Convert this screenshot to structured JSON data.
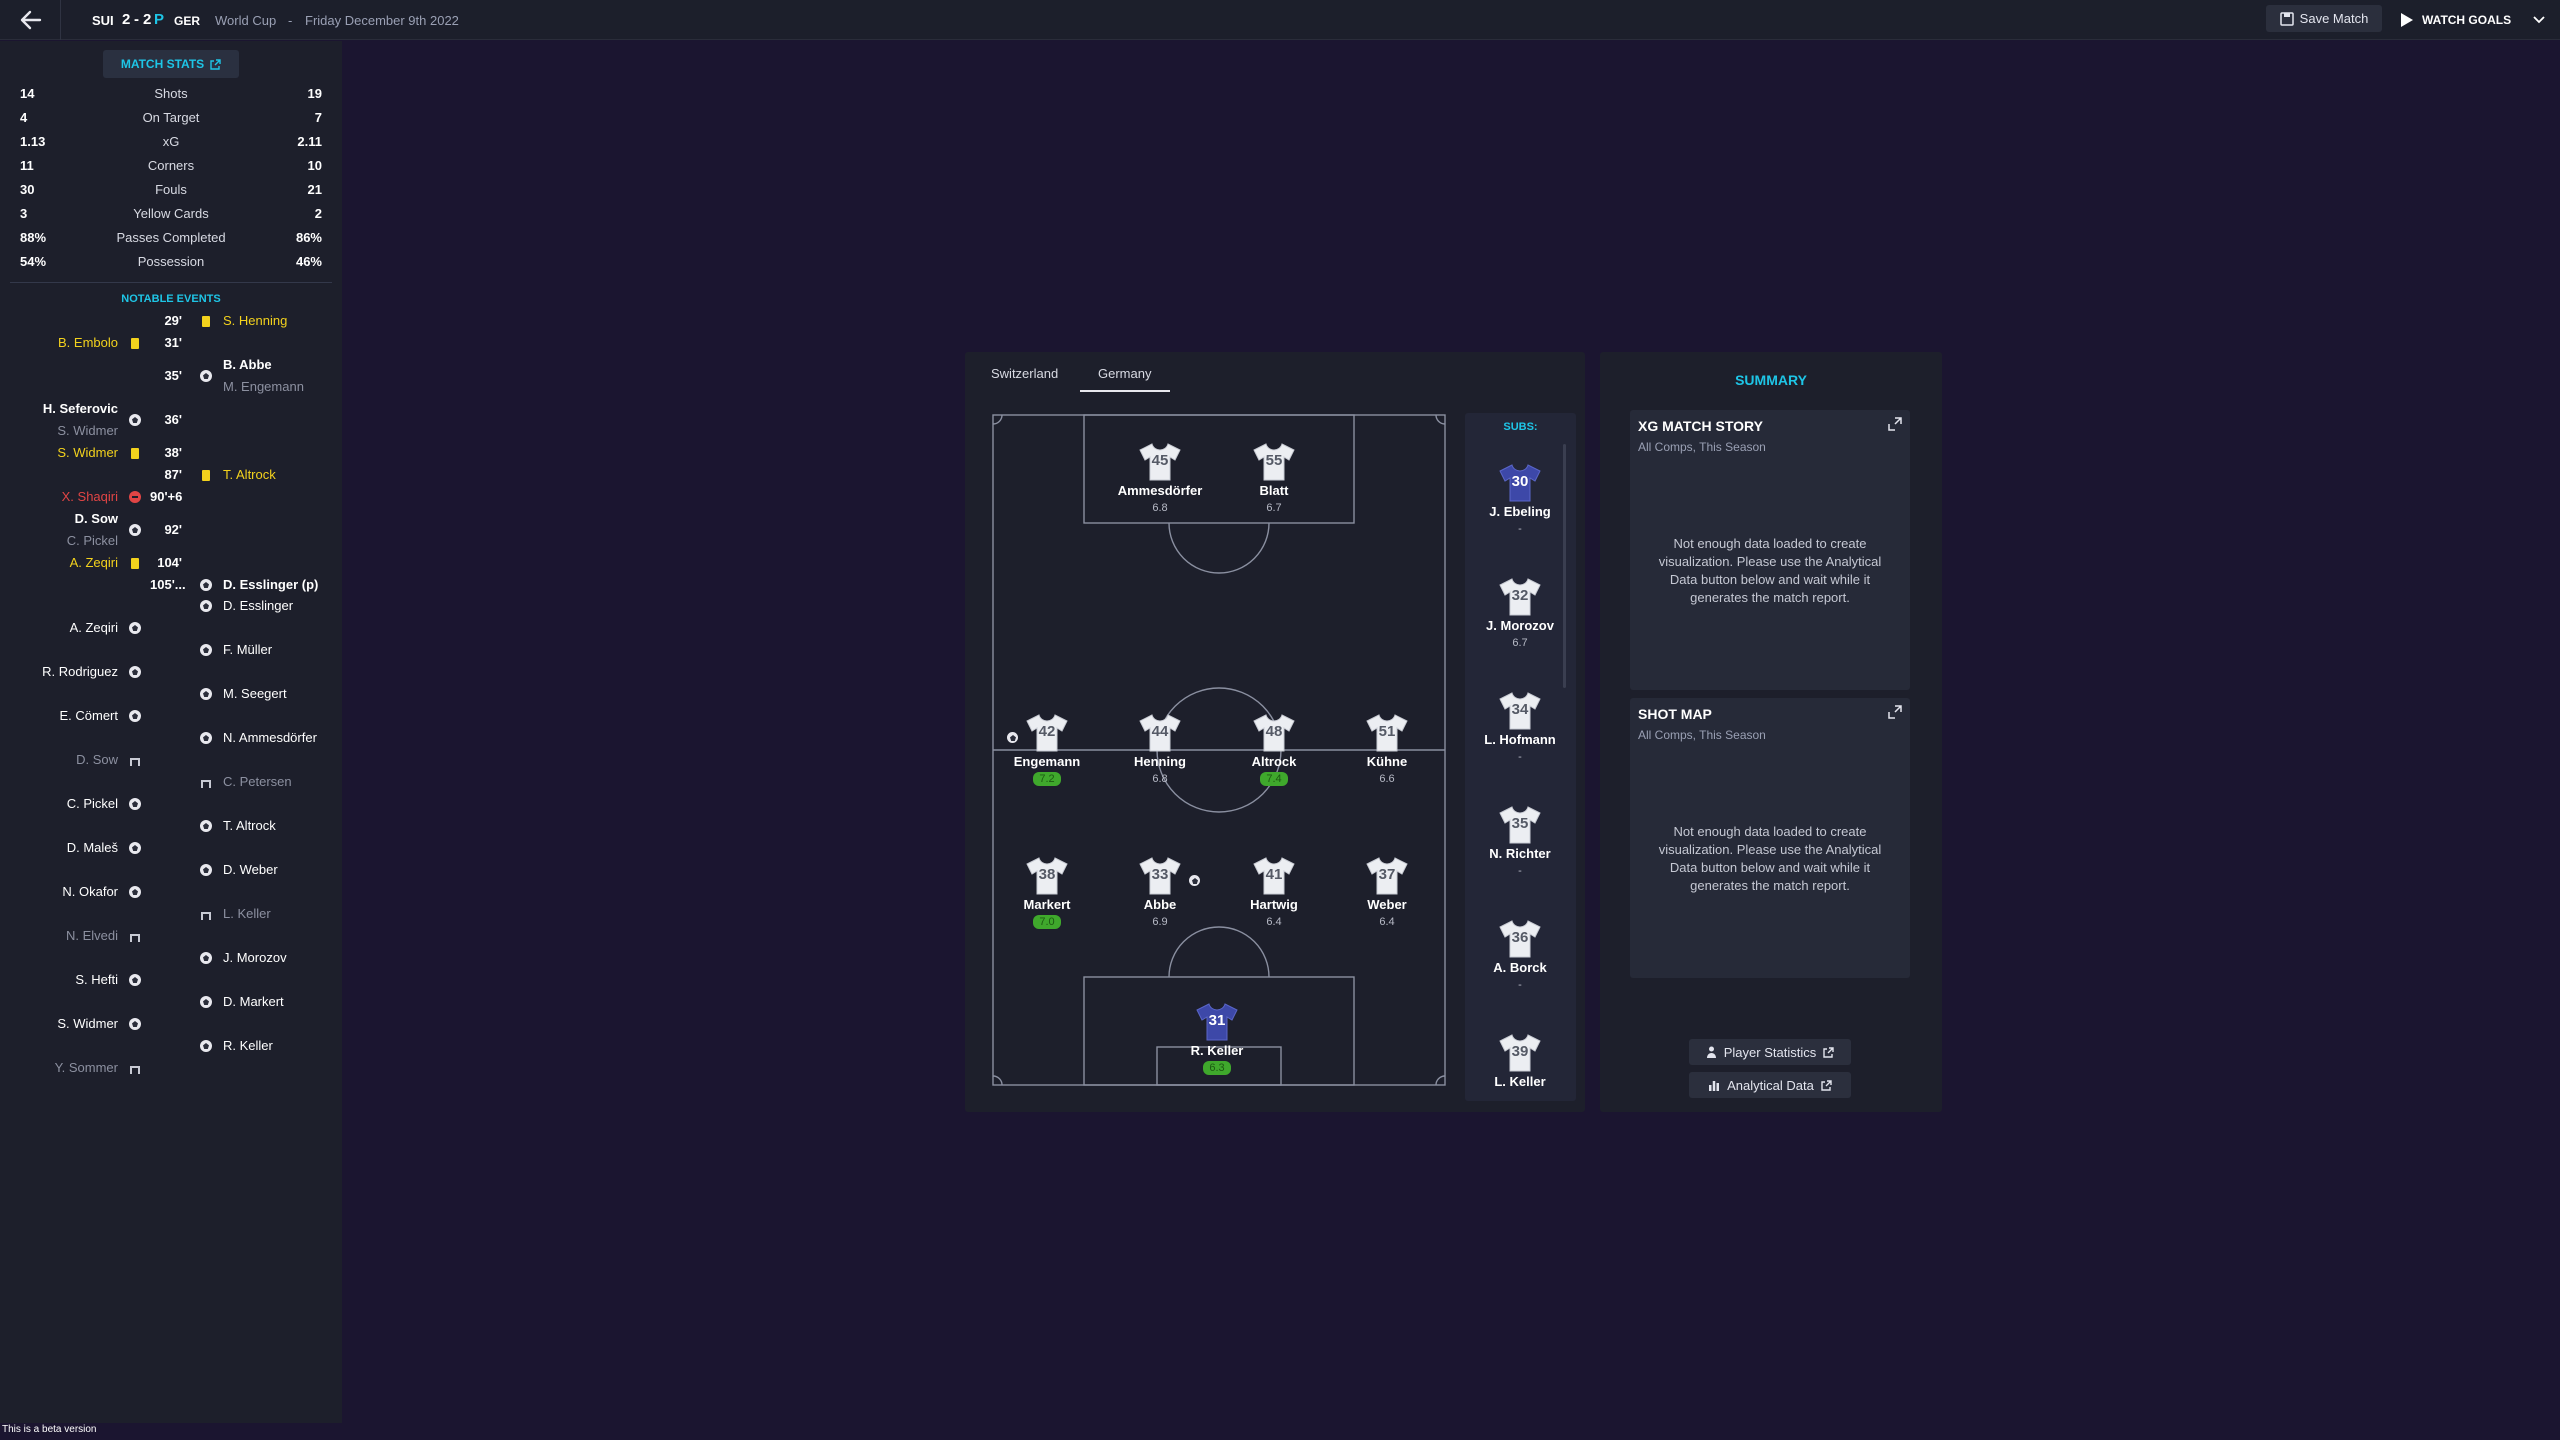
{
  "topbar": {
    "home_abbr": "SUI",
    "score_home": "2",
    "score_sep": "-",
    "score_away": "2",
    "penalty_marker": "P",
    "away_abbr": "GER",
    "competition": "World Cup",
    "separator": "-",
    "date": "Friday December 9th 2022",
    "save_label": "Save Match",
    "watch_label": "WATCH GOALS"
  },
  "match_stats": {
    "button_label": "MATCH STATS",
    "rows": [
      {
        "label": "Shots",
        "home": "14",
        "away": "19"
      },
      {
        "label": "On Target",
        "home": "4",
        "away": "7"
      },
      {
        "label": "xG",
        "home": "1.13",
        "away": "2.11"
      },
      {
        "label": "Corners",
        "home": "11",
        "away": "10"
      },
      {
        "label": "Fouls",
        "home": "30",
        "away": "21"
      },
      {
        "label": "Yellow Cards",
        "home": "3",
        "away": "2"
      },
      {
        "label": "Passes Completed",
        "home": "88%",
        "away": "86%"
      },
      {
        "label": "Possession",
        "home": "54%",
        "away": "46%"
      }
    ]
  },
  "notable_events": {
    "title": "NOTABLE EVENTS",
    "events": [
      {
        "minute": "29'",
        "side": "away",
        "type": "yellow",
        "name": "S. Henning",
        "sub": ""
      },
      {
        "minute": "31'",
        "side": "home",
        "type": "yellow",
        "name": "B. Embolo",
        "sub": ""
      },
      {
        "minute": "35'",
        "side": "away",
        "type": "goal",
        "name": "B. Abbe",
        "sub": "M. Engemann"
      },
      {
        "minute": "36'",
        "side": "home",
        "type": "goal",
        "name": "H. Seferovic",
        "sub": "S. Widmer"
      },
      {
        "minute": "38'",
        "side": "home",
        "type": "yellow",
        "name": "S. Widmer",
        "sub": ""
      },
      {
        "minute": "87'",
        "side": "away",
        "type": "yellow",
        "name": "T. Altrock",
        "sub": ""
      },
      {
        "minute": "90'+6",
        "side": "home",
        "type": "red",
        "name": "X. Shaqiri",
        "sub": ""
      },
      {
        "minute": "92'",
        "side": "home",
        "type": "goal",
        "name": "D. Sow",
        "sub": "C. Pickel"
      },
      {
        "minute": "104'",
        "side": "home",
        "type": "yellow",
        "name": "A. Zeqiri",
        "sub": ""
      },
      {
        "minute": "105'...",
        "side": "away",
        "type": "goal",
        "name": "D. Esslinger (p)",
        "sub": ""
      }
    ],
    "shootout_away": [
      {
        "name": "D. Esslinger",
        "result": "scored"
      },
      {
        "name": "F. Müller",
        "result": "scored"
      },
      {
        "name": "M. Seegert",
        "result": "scored"
      },
      {
        "name": "N. Ammesdörfer",
        "result": "scored"
      },
      {
        "name": "C. Petersen",
        "result": "missed"
      },
      {
        "name": "T. Altrock",
        "result": "scored"
      },
      {
        "name": "D. Weber",
        "result": "scored"
      },
      {
        "name": "L. Keller",
        "result": "missed"
      },
      {
        "name": "J. Morozov",
        "result": "scored"
      },
      {
        "name": "D. Markert",
        "result": "scored"
      },
      {
        "name": "R. Keller",
        "result": "scored"
      }
    ],
    "shootout_home": [
      {
        "name": "A. Zeqiri",
        "result": "scored"
      },
      {
        "name": "R. Rodriguez",
        "result": "scored"
      },
      {
        "name": "E. Cömert",
        "result": "scored"
      },
      {
        "name": "D. Sow",
        "result": "missed"
      },
      {
        "name": "C. Pickel",
        "result": "scored"
      },
      {
        "name": "D. Maleš",
        "result": "scored"
      },
      {
        "name": "N. Okafor",
        "result": "scored"
      },
      {
        "name": "N. Elvedi",
        "result": "missed"
      },
      {
        "name": "S. Hefti",
        "result": "scored"
      },
      {
        "name": "S. Widmer",
        "result": "scored"
      },
      {
        "name": "Y. Sommer",
        "result": "missed"
      }
    ]
  },
  "lineup": {
    "tabs": [
      "Switzerland",
      "Germany"
    ],
    "active_tab": "Germany",
    "subs_title": "SUBS:",
    "players": [
      {
        "num": "45",
        "name": "Ammesdörfer",
        "rating": "6.8",
        "good": false,
        "gk": false
      },
      {
        "num": "55",
        "name": "Blatt",
        "rating": "6.7",
        "good": false,
        "gk": false
      },
      {
        "num": "42",
        "name": "Engemann",
        "rating": "7.2",
        "good": true,
        "gk": false
      },
      {
        "num": "44",
        "name": "Henning",
        "rating": "6.8",
        "good": false,
        "gk": false
      },
      {
        "num": "48",
        "name": "Altrock",
        "rating": "7.4",
        "good": true,
        "gk": false
      },
      {
        "num": "51",
        "name": "Kühne",
        "rating": "6.6",
        "good": false,
        "gk": false
      },
      {
        "num": "38",
        "name": "Markert",
        "rating": "7.0",
        "good": true,
        "gk": false
      },
      {
        "num": "33",
        "name": "Abbe",
        "rating": "6.9",
        "good": false,
        "gk": false
      },
      {
        "num": "41",
        "name": "Hartwig",
        "rating": "6.4",
        "good": false,
        "gk": false
      },
      {
        "num": "37",
        "name": "Weber",
        "rating": "6.4",
        "good": false,
        "gk": false
      },
      {
        "num": "31",
        "name": "R. Keller",
        "rating": "6.3",
        "good": true,
        "gk": true
      }
    ],
    "subs": [
      {
        "num": "30",
        "name": "J. Ebeling",
        "rating": "-",
        "gk": true
      },
      {
        "num": "32",
        "name": "J. Morozov",
        "rating": "6.7",
        "gk": false
      },
      {
        "num": "34",
        "name": "L. Hofmann",
        "rating": "-",
        "gk": false
      },
      {
        "num": "35",
        "name": "N. Richter",
        "rating": "-",
        "gk": false
      },
      {
        "num": "36",
        "name": "A. Borck",
        "rating": "-",
        "gk": false
      },
      {
        "num": "39",
        "name": "L. Keller",
        "rating": "",
        "gk": false
      }
    ]
  },
  "summary": {
    "title": "SUMMARY",
    "xg_card": {
      "title": "XG MATCH STORY",
      "subtitle": "All Comps, This Season",
      "message": "Not enough data loaded to create visualization. Please use the Analytical Data button below and wait while it generates the match report."
    },
    "shot_card": {
      "title": "SHOT MAP",
      "subtitle": "All Comps, This Season",
      "message": "Not enough data loaded to create visualization. Please use the Analytical Data button below and wait while it generates the match report."
    },
    "player_stats_label": "Player Statistics",
    "analytical_label": "Analytical Data"
  },
  "footer": {
    "beta": "This is a beta version"
  },
  "colors": {
    "accent": "#1ec5e6",
    "yellow": "#f3d21d",
    "red": "#e14545",
    "rating_good": "#3fa82c",
    "gk_shirt": "#3d48a8"
  }
}
